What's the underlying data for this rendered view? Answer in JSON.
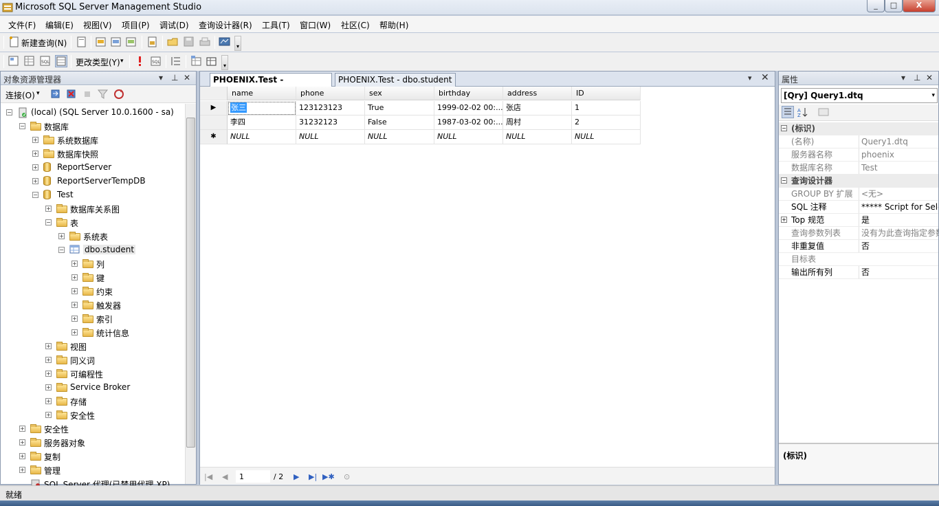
{
  "window": {
    "title": "Microsoft SQL Server Management Studio",
    "min": "_",
    "max": "□",
    "close": "X"
  },
  "menu": [
    "文件(F)",
    "编辑(E)",
    "视图(V)",
    "项目(P)",
    "调试(D)",
    "查询设计器(R)",
    "工具(T)",
    "窗口(W)",
    "社区(C)",
    "帮助(H)"
  ],
  "toolbar": {
    "new_query": "新建查询(N)",
    "change_type": "更改类型(Y)"
  },
  "object_explorer": {
    "title": "对象资源管理器",
    "connect": "连接(O)",
    "tree": [
      {
        "label": "(local) (SQL Server 10.0.1600 - sa)",
        "level": 0,
        "exp": "−",
        "icon": "server"
      },
      {
        "label": "数据库",
        "level": 1,
        "exp": "−",
        "icon": "folder"
      },
      {
        "label": "系统数据库",
        "level": 2,
        "exp": "+",
        "icon": "folder"
      },
      {
        "label": "数据库快照",
        "level": 2,
        "exp": "+",
        "icon": "folder"
      },
      {
        "label": "ReportServer",
        "level": 2,
        "exp": "+",
        "icon": "db"
      },
      {
        "label": "ReportServerTempDB",
        "level": 2,
        "exp": "+",
        "icon": "db"
      },
      {
        "label": "Test",
        "level": 2,
        "exp": "−",
        "icon": "db"
      },
      {
        "label": "数据库关系图",
        "level": 3,
        "exp": "+",
        "icon": "folder"
      },
      {
        "label": "表",
        "level": 3,
        "exp": "−",
        "icon": "folder"
      },
      {
        "label": "系统表",
        "level": 4,
        "exp": "+",
        "icon": "folder"
      },
      {
        "label": "dbo.student",
        "level": 4,
        "exp": "−",
        "icon": "table"
      },
      {
        "label": "列",
        "level": 5,
        "exp": "+",
        "icon": "folder"
      },
      {
        "label": "键",
        "level": 5,
        "exp": "+",
        "icon": "folder"
      },
      {
        "label": "约束",
        "level": 5,
        "exp": "+",
        "icon": "folder"
      },
      {
        "label": "触发器",
        "level": 5,
        "exp": "+",
        "icon": "folder"
      },
      {
        "label": "索引",
        "level": 5,
        "exp": "+",
        "icon": "folder"
      },
      {
        "label": "统计信息",
        "level": 5,
        "exp": "+",
        "icon": "folder"
      },
      {
        "label": "视图",
        "level": 3,
        "exp": "+",
        "icon": "folder"
      },
      {
        "label": "同义词",
        "level": 3,
        "exp": "+",
        "icon": "folder"
      },
      {
        "label": "可编程性",
        "level": 3,
        "exp": "+",
        "icon": "folder"
      },
      {
        "label": "Service Broker",
        "level": 3,
        "exp": "+",
        "icon": "folder"
      },
      {
        "label": "存储",
        "level": 3,
        "exp": "+",
        "icon": "folder"
      },
      {
        "label": "安全性",
        "level": 3,
        "exp": "+",
        "icon": "folder"
      },
      {
        "label": "安全性",
        "level": 1,
        "exp": "+",
        "icon": "folder"
      },
      {
        "label": "服务器对象",
        "level": 1,
        "exp": "+",
        "icon": "folder"
      },
      {
        "label": "复制",
        "level": 1,
        "exp": "+",
        "icon": "folder"
      },
      {
        "label": "管理",
        "level": 1,
        "exp": "+",
        "icon": "folder"
      },
      {
        "label": "SQL Server 代理(已禁用代理 XP)",
        "level": 1,
        "exp": "",
        "icon": "agent"
      }
    ]
  },
  "document": {
    "tabs": [
      "PHOENIX.Test - dbo.student",
      "PHOENIX.Test - dbo.student"
    ],
    "columns": [
      "name",
      "phone",
      "sex",
      "birthday",
      "address",
      "ID"
    ],
    "rows": [
      [
        "张三",
        "123123123",
        "True",
        "1999-02-02 00:...",
        "张店",
        "1"
      ],
      [
        "李四",
        "31232123",
        "False",
        "1987-03-02 00:...",
        "周村",
        "2"
      ],
      [
        "NULL",
        "NULL",
        "NULL",
        "NULL",
        "NULL",
        "NULL"
      ]
    ],
    "row_markers": [
      "▶",
      "",
      "✱"
    ],
    "nav": {
      "page": "1",
      "total": "/ 2"
    }
  },
  "properties": {
    "title": "属性",
    "object": "[Qry] Query1.dtq",
    "rows": [
      {
        "type": "cat",
        "key": "(标识)",
        "exp": "−"
      },
      {
        "type": "prop",
        "key": "(名称)",
        "value": "Query1.dtq",
        "grey": true
      },
      {
        "type": "prop",
        "key": "服务器名称",
        "value": "phoenix",
        "grey": true
      },
      {
        "type": "prop",
        "key": "数据库名称",
        "value": "Test",
        "grey": true
      },
      {
        "type": "cat",
        "key": "查询设计器",
        "exp": "−"
      },
      {
        "type": "prop",
        "key": "GROUP BY 扩展",
        "value": "<无>",
        "grey": true
      },
      {
        "type": "prop",
        "key": "SQL 注释",
        "value": "***** Script for Selec",
        "grey": false
      },
      {
        "type": "prop",
        "key": "Top 规范",
        "value": "是",
        "grey": false,
        "exp": "+"
      },
      {
        "type": "prop",
        "key": "查询参数列表",
        "value": "没有为此查询指定参数",
        "grey": true
      },
      {
        "type": "prop",
        "key": "非重复值",
        "value": "否",
        "grey": false
      },
      {
        "type": "prop",
        "key": "目标表",
        "value": "",
        "grey": true
      },
      {
        "type": "prop",
        "key": "输出所有列",
        "value": "否",
        "grey": false
      }
    ],
    "desc": "(标识)"
  },
  "status": "就绪"
}
